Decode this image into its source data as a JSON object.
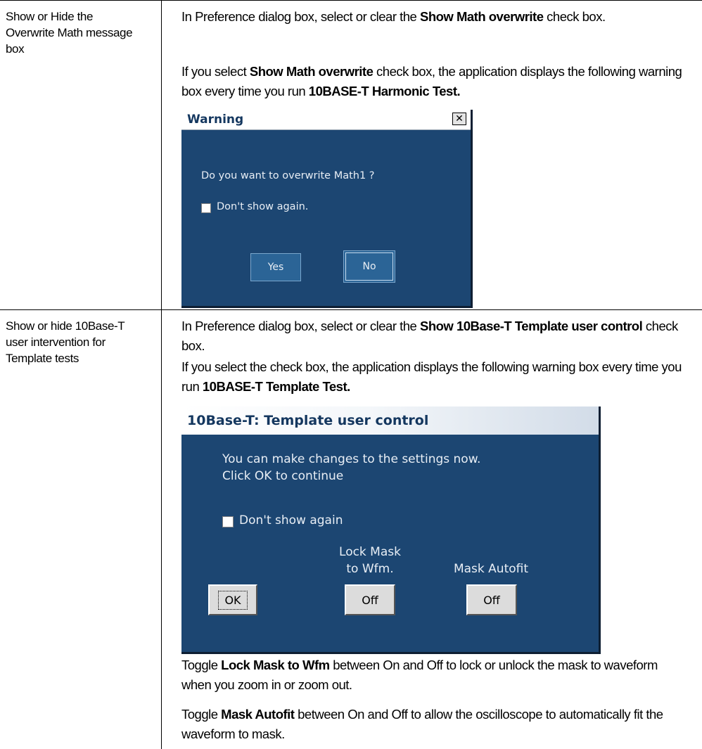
{
  "rows": [
    {
      "label": "Show or Hide the Overwrite Math message box",
      "para1": {
        "pre": "In Preference dialog box, select or clear the ",
        "bold": "Show Math overwrite",
        "post": " check box."
      },
      "para2": {
        "pre": "If you select ",
        "bold": "Show Math overwrite",
        "mid": " check box, the application displays the following warning box every time you run ",
        "bold2": "10BASE-T Harmonic Test."
      }
    },
    {
      "label": "Show or hide 10Base-T user intervention for Template tests",
      "para1": {
        "pre": "In Preference dialog box, select or clear the ",
        "bold": "Show 10Base-T Template user control",
        "post": " check box."
      },
      "para2": {
        "pre": "If you select the check box, the application displays the following warning box every time you run ",
        "bold": "10BASE-T Template Test."
      },
      "para3": {
        "pre": "Toggle ",
        "bold": "Lock Mask to Wfm",
        "post": " between On and Off to lock or unlock the mask to waveform when you zoom in or zoom out."
      },
      "para4": {
        "pre": "Toggle ",
        "bold": "Mask Autofit",
        "post": " between On and Off to allow the oscilloscope to automatically fit the waveform to mask."
      }
    }
  ],
  "warning_dialog": {
    "title": "Warning",
    "close_glyph": "✕",
    "message": "Do you want to overwrite Math1 ?",
    "checkbox_label": "Don't show again.",
    "yes_label": "Yes",
    "no_label": "No"
  },
  "template_dialog": {
    "title": "10Base-T: Template user control",
    "message_line1": "You can make changes to the settings now.",
    "message_line2": "Click OK to continue",
    "checkbox_label": "Don't show again",
    "ok_label": "OK",
    "lock_mask_label_line1": "Lock Mask",
    "lock_mask_label_line2": "to Wfm.",
    "lock_mask_value": "Off",
    "mask_autofit_label": "Mask Autofit",
    "mask_autofit_value": "Off"
  },
  "colors": {
    "dialog_bg": "#1c4672",
    "dialog_button": "#2b6496",
    "dialog_title": "#14375f"
  }
}
